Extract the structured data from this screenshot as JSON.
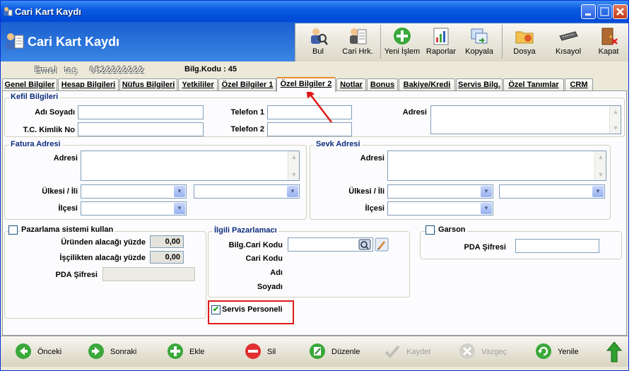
{
  "window": {
    "title": "Cari Kart Kaydı",
    "heading": "Cari Kart Kaydı"
  },
  "toolbar": {
    "bul": "Bul",
    "cari_hrk": "Cari Hrk.",
    "yeni_islem": "Yeni İşlem",
    "raporlar": "Raporlar",
    "kopyala": "Kopyala",
    "dosya": "Dosya",
    "kisayol": "Kısayol",
    "kapat": "Kapat"
  },
  "info": {
    "name": "Emel",
    "surname": "taş",
    "phone": "0522222222",
    "bilg_kodu": "Bilg.Kodu : 45"
  },
  "tabs": [
    "Genel Bilgiler",
    "Hesap Bilgileri",
    "Nüfus Bilgileri",
    "Yetkililer",
    "Özel Bilgiler 1",
    "Özel Bilgiler 2",
    "Notlar",
    "Bonus",
    "Bakiye/Kredi",
    "Servis Bilg.",
    "Özel Tanımlar",
    "CRM"
  ],
  "kefil": {
    "legend": "Kefil Bilgileri",
    "adi_soyadi": "Adı Soyadı",
    "tc": "T.C. Kimlik No",
    "tel1": "Telefon 1",
    "tel2": "Telefon 2",
    "adres": "Adresi"
  },
  "fatura": {
    "legend": "Fatura Adresi",
    "adres": "Adresi",
    "ulke_il": "Ülkesi / İli",
    "ilce": "İlçesi"
  },
  "sevk": {
    "legend": "Sevk Adresi",
    "adres": "Adresi",
    "ulke_il": "Ülkesi / İli",
    "ilce": "İlçesi"
  },
  "pazarlama": {
    "check_label": "Pazarlama sistemi kullan",
    "urun_label": "Üründen alacağı yüzde",
    "urun_val": "0,00",
    "iscilik_label": "İşçilikten alacağı yüzde",
    "iscilik_val": "0,00",
    "pda_label": "PDA Şifresi"
  },
  "ilgili": {
    "legend": "İlgili Pazarlamacı",
    "bilg_cari": "Bilg.Cari Kodu",
    "cari_kodu": "Cari Kodu",
    "adi": "Adı",
    "soyadi": "Soyadı"
  },
  "servis": {
    "label": "Servis Personeli",
    "checked": true
  },
  "garson": {
    "label": "Garson",
    "pda_label": "PDA Şifresi"
  },
  "bottom": {
    "onceki": "Önceki",
    "sonraki": "Sonraki",
    "ekle": "Ekle",
    "sil": "Sil",
    "duzenle": "Düzenle",
    "kaydet": "Kaydet",
    "vazgec": "Vazgeç",
    "yenile": "Yenile"
  }
}
